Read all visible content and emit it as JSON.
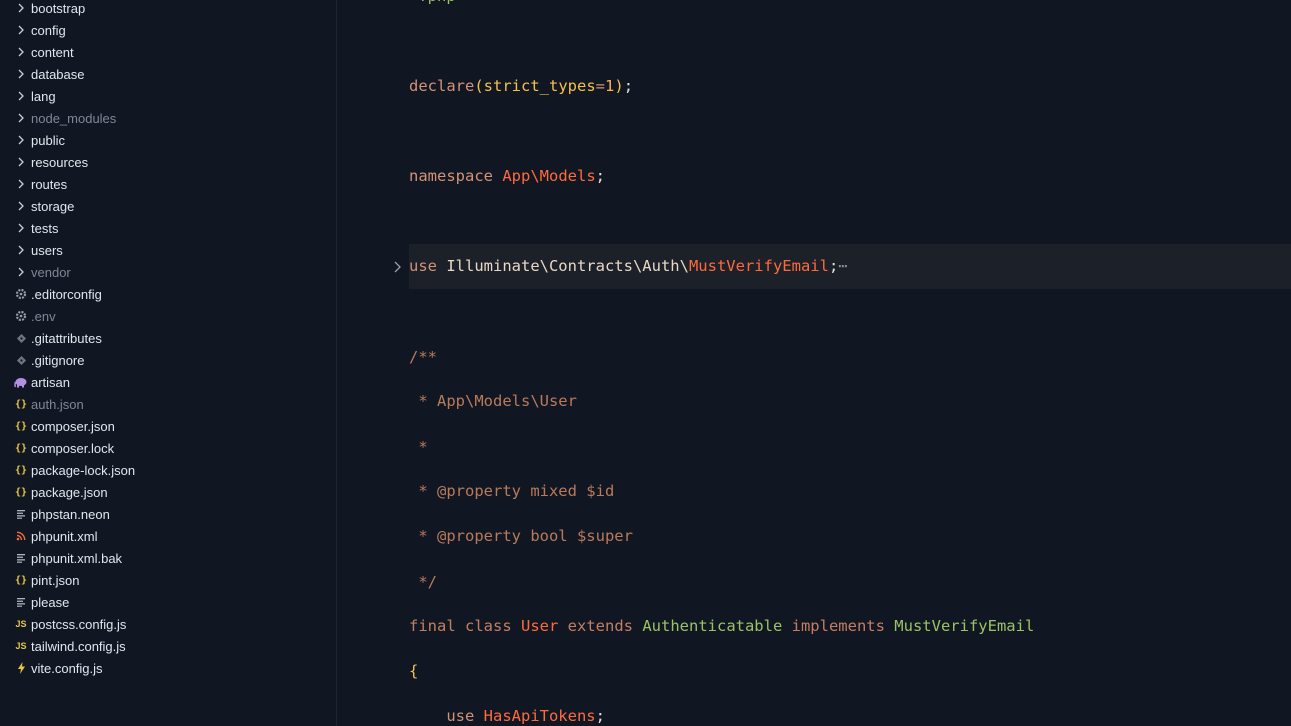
{
  "sidebar": {
    "items": [
      {
        "label": "bootstrap",
        "icon": "chevron-right-icon",
        "dim": false
      },
      {
        "label": "config",
        "icon": "chevron-right-icon",
        "dim": false
      },
      {
        "label": "content",
        "icon": "chevron-right-icon",
        "dim": false
      },
      {
        "label": "database",
        "icon": "chevron-right-icon",
        "dim": false
      },
      {
        "label": "lang",
        "icon": "chevron-right-icon",
        "dim": false
      },
      {
        "label": "node_modules",
        "icon": "chevron-right-icon",
        "dim": true
      },
      {
        "label": "public",
        "icon": "chevron-right-icon",
        "dim": false
      },
      {
        "label": "resources",
        "icon": "chevron-right-icon",
        "dim": false
      },
      {
        "label": "routes",
        "icon": "chevron-right-icon",
        "dim": false
      },
      {
        "label": "storage",
        "icon": "chevron-right-icon",
        "dim": false
      },
      {
        "label": "tests",
        "icon": "chevron-right-icon",
        "dim": false
      },
      {
        "label": "users",
        "icon": "chevron-right-icon",
        "dim": false
      },
      {
        "label": "vendor",
        "icon": "chevron-right-icon",
        "dim": true
      },
      {
        "label": ".editorconfig",
        "icon": "gear-icon",
        "dim": false
      },
      {
        "label": ".env",
        "icon": "gear-icon",
        "dim": true
      },
      {
        "label": ".gitattributes",
        "icon": "git-icon",
        "dim": false
      },
      {
        "label": ".gitignore",
        "icon": "git-icon",
        "dim": false
      },
      {
        "label": "artisan",
        "icon": "elephant-icon",
        "dim": false
      },
      {
        "label": "auth.json",
        "icon": "json-icon",
        "dim": true
      },
      {
        "label": "composer.json",
        "icon": "json-icon",
        "dim": false
      },
      {
        "label": "composer.lock",
        "icon": "json-icon",
        "dim": false
      },
      {
        "label": "package-lock.json",
        "icon": "json-icon",
        "dim": false
      },
      {
        "label": "package.json",
        "icon": "json-icon",
        "dim": false
      },
      {
        "label": "phpstan.neon",
        "icon": "text-file-icon",
        "dim": false
      },
      {
        "label": "phpunit.xml",
        "icon": "rss-icon",
        "dim": false
      },
      {
        "label": "phpunit.xml.bak",
        "icon": "text-file-icon",
        "dim": false
      },
      {
        "label": "pint.json",
        "icon": "json-icon",
        "dim": false
      },
      {
        "label": "please",
        "icon": "text-file-icon",
        "dim": false
      },
      {
        "label": "postcss.config.js",
        "icon": "js-icon",
        "dim": false
      },
      {
        "label": "tailwind.config.js",
        "icon": "js-icon",
        "dim": false
      },
      {
        "label": "vite.config.js",
        "icon": "bolt-icon",
        "dim": false
      }
    ]
  },
  "editor": {
    "lines": [
      [
        {
          "t": "<?php",
          "c": "green"
        }
      ],
      [
        {
          "t": "declare",
          "c": "kw"
        },
        {
          "t": "(",
          "c": "paren"
        },
        {
          "t": "strict_types",
          "c": "paren"
        },
        {
          "t": "=",
          "c": "kw"
        },
        {
          "t": "1",
          "c": "num"
        },
        {
          "t": ")",
          "c": "paren"
        },
        {
          "t": ";",
          "c": "punc"
        }
      ],
      [
        {
          "t": "namespace ",
          "c": "kw"
        },
        {
          "t": "App\\Models",
          "c": "ns"
        },
        {
          "t": ";",
          "c": "punc"
        }
      ],
      [
        {
          "t": "use ",
          "c": "kw"
        },
        {
          "t": "Illuminate\\Contracts\\Auth\\",
          "c": "plain"
        },
        {
          "t": "MustVerifyEmail",
          "c": "ns"
        },
        {
          "t": ";",
          "c": "punc"
        },
        {
          "t": "⋯",
          "c": "ell"
        }
      ],
      [
        {
          "t": "/**",
          "c": "comment"
        }
      ],
      [
        {
          "t": " * App\\Models\\User",
          "c": "comment"
        }
      ],
      [
        {
          "t": " *",
          "c": "comment"
        }
      ],
      [
        {
          "t": " * @property mixed $id",
          "c": "comment"
        }
      ],
      [
        {
          "t": " * @property bool $super",
          "c": "comment"
        }
      ],
      [
        {
          "t": " */",
          "c": "comment"
        }
      ],
      [
        {
          "t": "final ",
          "c": "kwd"
        },
        {
          "t": "class ",
          "c": "kwd"
        },
        {
          "t": "User ",
          "c": "ns"
        },
        {
          "t": "extends ",
          "c": "kwd"
        },
        {
          "t": "Authenticatable ",
          "c": "green"
        },
        {
          "t": "implements ",
          "c": "kwd"
        },
        {
          "t": "MustVerifyEmail",
          "c": "green"
        }
      ],
      [
        {
          "t": "{",
          "c": "paren"
        }
      ],
      [
        {
          "t": "    use ",
          "c": "kw"
        },
        {
          "t": "HasApiTokens",
          "c": "ns"
        },
        {
          "t": ";",
          "c": "punc"
        }
      ]
    ]
  }
}
